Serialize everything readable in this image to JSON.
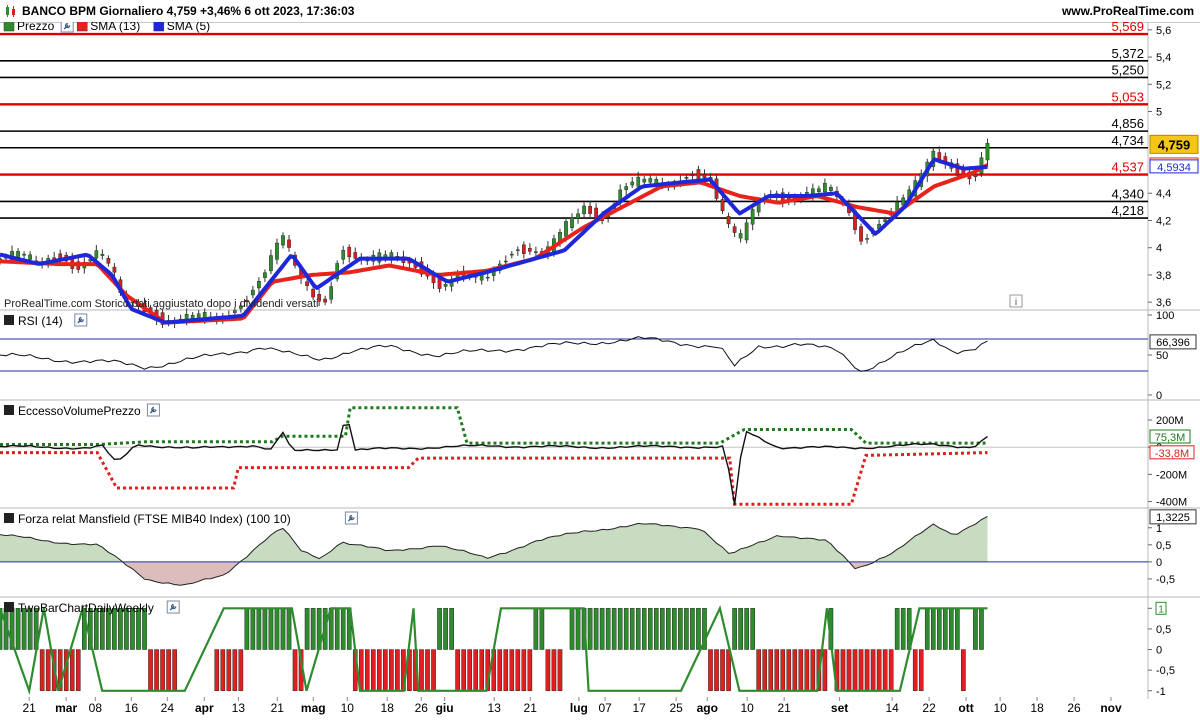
{
  "header": {
    "title": "BANCO BPM Giornaliero 4,759 +3,46% 6 ott 2023, 17:36:03",
    "site": "www.ProRealTime.com"
  },
  "colors": {
    "price_up": "#2e8b2e",
    "price_down": "#d62020",
    "sma13": "#e8231c",
    "sma5": "#1e28d8",
    "level_red": "#e00000",
    "level_black": "#000000",
    "rsi_band": "#2030a0",
    "highlight": "#f5c518"
  },
  "icons": [
    "candlestick-logo-icon",
    "wrench-icon",
    "info-icon"
  ],
  "price_panel": {
    "legend": [
      {
        "label": "Prezzo",
        "color": "#2e8b2e",
        "icon": "candlestick-icon"
      },
      {
        "label": "SMA (13)",
        "color": "#e8231c"
      },
      {
        "label": "SMA (5)",
        "color": "#1e28d8"
      }
    ],
    "watermark": "ProRealTime.com  Storico dati aggiustato dopo i dividendi versati",
    "levels": [
      {
        "value": 5.569,
        "label": "5,569",
        "color": "red"
      },
      {
        "value": 5.372,
        "label": "5,372",
        "color": "black"
      },
      {
        "value": 5.25,
        "label": "5,250",
        "color": "black"
      },
      {
        "value": 5.053,
        "label": "5,053",
        "color": "red"
      },
      {
        "value": 4.856,
        "label": "4,856",
        "color": "black"
      },
      {
        "value": 4.734,
        "label": "4,734",
        "color": "black"
      },
      {
        "value": 4.537,
        "label": "4,537",
        "color": "red"
      },
      {
        "value": 4.34,
        "label": "4,340",
        "color": "black"
      },
      {
        "value": 4.218,
        "label": "4,218",
        "color": "black"
      }
    ],
    "y_ticks": [
      {
        "v": 5.6,
        "label": "5,6"
      },
      {
        "v": 5.4,
        "label": "5,4"
      },
      {
        "v": 5.2,
        "label": "5,2"
      },
      {
        "v": 5.0,
        "label": "5"
      },
      {
        "v": 4.4,
        "label": "4,4"
      },
      {
        "v": 4.2,
        "label": "4,2"
      },
      {
        "v": 4.0,
        "label": "4"
      },
      {
        "v": 3.8,
        "label": "3,8"
      },
      {
        "v": 3.6,
        "label": "3,6"
      }
    ],
    "badges": [
      {
        "value": 4.759,
        "label": "4,759",
        "style": "price"
      },
      {
        "value": 4.6075,
        "label": "4,6075",
        "style": "sma13"
      },
      {
        "value": 4.5934,
        "label": "4,5934",
        "style": "sma5"
      }
    ]
  },
  "rsi_panel": {
    "legend": "RSI (14)",
    "y_ticks": [
      {
        "v": 100,
        "label": "100"
      },
      {
        "v": 50,
        "label": "50"
      },
      {
        "v": 0,
        "label": "0"
      }
    ],
    "badge": "66,396"
  },
  "volume_panel": {
    "legend": "EccessoVolumePrezzo",
    "y_ticks": [
      {
        "v": 200,
        "label": "200M"
      },
      {
        "v": 0,
        "label": "0"
      },
      {
        "v": -200,
        "label": "-200M"
      },
      {
        "v": -400,
        "label": "-400M"
      }
    ],
    "badges": [
      "75,3M",
      "-33,8M"
    ]
  },
  "mansfield_panel": {
    "legend": "Forza relat Mansfield (FTSE MIB40 Index) (100 10)",
    "y_ticks": [
      {
        "v": 1,
        "label": "1"
      },
      {
        "v": 0.5,
        "label": "0,5"
      },
      {
        "v": 0,
        "label": "0"
      },
      {
        "v": -0.5,
        "label": "-0,5"
      }
    ],
    "badge": "1,3225"
  },
  "twobar_panel": {
    "legend": "TwoBarChartDailyWeekly",
    "y_ticks": [
      {
        "v": 1,
        "label": "1"
      },
      {
        "v": 0.5,
        "label": "0,5"
      },
      {
        "v": 0,
        "label": "0"
      },
      {
        "v": -0.5,
        "label": "-0,5"
      },
      {
        "v": -1,
        "label": "-1"
      }
    ],
    "badge": "1"
  },
  "x_axis": {
    "labels": [
      {
        "t": 0.03,
        "label": "21",
        "bold": false
      },
      {
        "t": 0.068,
        "label": "mar",
        "bold": true
      },
      {
        "t": 0.098,
        "label": "08",
        "bold": false
      },
      {
        "t": 0.135,
        "label": "16",
        "bold": false
      },
      {
        "t": 0.172,
        "label": "24",
        "bold": false
      },
      {
        "t": 0.21,
        "label": "apr",
        "bold": true
      },
      {
        "t": 0.245,
        "label": "13",
        "bold": false
      },
      {
        "t": 0.285,
        "label": "21",
        "bold": false
      },
      {
        "t": 0.322,
        "label": "mag",
        "bold": true
      },
      {
        "t": 0.357,
        "label": "10",
        "bold": false
      },
      {
        "t": 0.398,
        "label": "18",
        "bold": false
      },
      {
        "t": 0.433,
        "label": "26",
        "bold": false
      },
      {
        "t": 0.457,
        "label": "giu",
        "bold": true
      },
      {
        "t": 0.508,
        "label": "13",
        "bold": false
      },
      {
        "t": 0.545,
        "label": "21",
        "bold": false
      },
      {
        "t": 0.595,
        "label": "lug",
        "bold": true
      },
      {
        "t": 0.622,
        "label": "07",
        "bold": false
      },
      {
        "t": 0.657,
        "label": "17",
        "bold": false
      },
      {
        "t": 0.695,
        "label": "25",
        "bold": false
      },
      {
        "t": 0.727,
        "label": "ago",
        "bold": true
      },
      {
        "t": 0.768,
        "label": "10",
        "bold": false
      },
      {
        "t": 0.806,
        "label": "21",
        "bold": false
      },
      {
        "t": 0.863,
        "label": "set",
        "bold": true
      },
      {
        "t": 0.917,
        "label": "14",
        "bold": false
      },
      {
        "t": 0.955,
        "label": "22",
        "bold": false
      },
      {
        "t": 0.993,
        "label": "ott",
        "bold": true
      },
      {
        "t": 1.028,
        "label": "10",
        "bold": false
      },
      {
        "t": 1.066,
        "label": "18",
        "bold": false
      },
      {
        "t": 1.104,
        "label": "26",
        "bold": false
      },
      {
        "t": 1.142,
        "label": "nov",
        "bold": true
      }
    ]
  },
  "chart_data": {
    "type": "line",
    "series": [
      {
        "name": "Prezzo",
        "keyframes": [
          [
            0,
            3.92
          ],
          [
            0.02,
            3.96
          ],
          [
            0.04,
            3.88
          ],
          [
            0.06,
            3.95
          ],
          [
            0.08,
            3.85
          ],
          [
            0.1,
            3.97
          ],
          [
            0.115,
            3.85
          ],
          [
            0.125,
            3.62
          ],
          [
            0.15,
            3.55
          ],
          [
            0.17,
            3.45
          ],
          [
            0.2,
            3.5
          ],
          [
            0.23,
            3.48
          ],
          [
            0.25,
            3.6
          ],
          [
            0.27,
            3.8
          ],
          [
            0.29,
            4.1
          ],
          [
            0.305,
            3.82
          ],
          [
            0.32,
            3.65
          ],
          [
            0.335,
            3.6
          ],
          [
            0.35,
            4.0
          ],
          [
            0.37,
            3.9
          ],
          [
            0.4,
            3.95
          ],
          [
            0.43,
            3.86
          ],
          [
            0.455,
            3.7
          ],
          [
            0.47,
            3.8
          ],
          [
            0.5,
            3.78
          ],
          [
            0.53,
            4.0
          ],
          [
            0.56,
            3.95
          ],
          [
            0.58,
            4.15
          ],
          [
            0.6,
            4.3
          ],
          [
            0.62,
            4.2
          ],
          [
            0.64,
            4.45
          ],
          [
            0.66,
            4.5
          ],
          [
            0.69,
            4.45
          ],
          [
            0.71,
            4.55
          ],
          [
            0.73,
            4.5
          ],
          [
            0.745,
            4.2
          ],
          [
            0.76,
            4.05
          ],
          [
            0.775,
            4.3
          ],
          [
            0.79,
            4.4
          ],
          [
            0.81,
            4.35
          ],
          [
            0.83,
            4.4
          ],
          [
            0.85,
            4.45
          ],
          [
            0.87,
            4.3
          ],
          [
            0.885,
            4.05
          ],
          [
            0.9,
            4.15
          ],
          [
            0.92,
            4.3
          ],
          [
            0.94,
            4.45
          ],
          [
            0.96,
            4.7
          ],
          [
            0.975,
            4.6
          ],
          [
            0.99,
            4.55
          ],
          [
            1.0,
            4.5
          ],
          [
            1.015,
            4.759
          ]
        ]
      },
      {
        "name": "SMA (13)",
        "keyframes": [
          [
            0,
            3.9
          ],
          [
            0.06,
            3.88
          ],
          [
            0.1,
            3.88
          ],
          [
            0.13,
            3.65
          ],
          [
            0.17,
            3.45
          ],
          [
            0.25,
            3.48
          ],
          [
            0.28,
            3.75
          ],
          [
            0.32,
            3.8
          ],
          [
            0.36,
            3.82
          ],
          [
            0.4,
            3.87
          ],
          [
            0.45,
            3.8
          ],
          [
            0.5,
            3.83
          ],
          [
            0.55,
            3.92
          ],
          [
            0.6,
            4.15
          ],
          [
            0.64,
            4.3
          ],
          [
            0.68,
            4.45
          ],
          [
            0.72,
            4.48
          ],
          [
            0.76,
            4.38
          ],
          [
            0.8,
            4.33
          ],
          [
            0.84,
            4.38
          ],
          [
            0.88,
            4.3
          ],
          [
            0.92,
            4.25
          ],
          [
            0.96,
            4.45
          ],
          [
            1.0,
            4.55
          ],
          [
            1.015,
            4.6075
          ]
        ]
      },
      {
        "name": "SMA (5)",
        "keyframes": [
          [
            0,
            3.95
          ],
          [
            0.04,
            3.88
          ],
          [
            0.09,
            3.95
          ],
          [
            0.115,
            3.8
          ],
          [
            0.135,
            3.55
          ],
          [
            0.17,
            3.45
          ],
          [
            0.25,
            3.5
          ],
          [
            0.3,
            3.95
          ],
          [
            0.325,
            3.7
          ],
          [
            0.37,
            3.92
          ],
          [
            0.42,
            3.92
          ],
          [
            0.46,
            3.75
          ],
          [
            0.5,
            3.82
          ],
          [
            0.55,
            3.92
          ],
          [
            0.58,
            3.98
          ],
          [
            0.62,
            4.25
          ],
          [
            0.66,
            4.45
          ],
          [
            0.7,
            4.48
          ],
          [
            0.73,
            4.5
          ],
          [
            0.76,
            4.25
          ],
          [
            0.79,
            4.38
          ],
          [
            0.83,
            4.38
          ],
          [
            0.86,
            4.4
          ],
          [
            0.9,
            4.1
          ],
          [
            0.93,
            4.3
          ],
          [
            0.96,
            4.65
          ],
          [
            0.99,
            4.58
          ],
          [
            1.015,
            4.5934
          ]
        ]
      },
      {
        "name": "RSI (14)",
        "keyframes": [
          [
            0,
            50
          ],
          [
            0.05,
            45
          ],
          [
            0.12,
            40
          ],
          [
            0.15,
            35
          ],
          [
            0.2,
            45
          ],
          [
            0.27,
            60
          ],
          [
            0.3,
            50
          ],
          [
            0.33,
            45
          ],
          [
            0.36,
            55
          ],
          [
            0.4,
            60
          ],
          [
            0.45,
            50
          ],
          [
            0.5,
            55
          ],
          [
            0.55,
            60
          ],
          [
            0.6,
            65
          ],
          [
            0.66,
            70
          ],
          [
            0.7,
            65
          ],
          [
            0.74,
            60
          ],
          [
            0.755,
            35
          ],
          [
            0.78,
            60
          ],
          [
            0.82,
            65
          ],
          [
            0.86,
            55
          ],
          [
            0.885,
            30
          ],
          [
            0.92,
            50
          ],
          [
            0.96,
            68
          ],
          [
            0.98,
            55
          ],
          [
            1.0,
            58
          ],
          [
            1.015,
            66.396
          ]
        ]
      },
      {
        "name": "EccessoVolumePrezzo",
        "keyframes": [
          [
            0,
            5
          ],
          [
            0.09,
            -5
          ],
          [
            0.105,
            10
          ],
          [
            0.12,
            -120
          ],
          [
            0.14,
            20
          ],
          [
            0.2,
            -10
          ],
          [
            0.26,
            15
          ],
          [
            0.28,
            -20
          ],
          [
            0.29,
            120
          ],
          [
            0.3,
            -30
          ],
          [
            0.35,
            -10
          ],
          [
            0.355,
            300
          ],
          [
            0.365,
            -20
          ],
          [
            0.45,
            0
          ],
          [
            0.5,
            10
          ],
          [
            0.6,
            0
          ],
          [
            0.7,
            5
          ],
          [
            0.745,
            0
          ],
          [
            0.755,
            -430
          ],
          [
            0.765,
            120
          ],
          [
            0.8,
            0
          ],
          [
            0.88,
            -5
          ],
          [
            0.92,
            10
          ],
          [
            0.96,
            20
          ],
          [
            1.0,
            0
          ],
          [
            1.015,
            75.3
          ]
        ]
      },
      {
        "name": "Mansfield",
        "keyframes": [
          [
            0,
            0.8
          ],
          [
            0.05,
            0.6
          ],
          [
            0.1,
            0.5
          ],
          [
            0.13,
            -0.1
          ],
          [
            0.15,
            -0.5
          ],
          [
            0.19,
            -0.7
          ],
          [
            0.23,
            -0.4
          ],
          [
            0.27,
            0.6
          ],
          [
            0.29,
            1.0
          ],
          [
            0.31,
            0.3
          ],
          [
            0.33,
            0.1
          ],
          [
            0.35,
            0.6
          ],
          [
            0.4,
            0.3
          ],
          [
            0.45,
            0.5
          ],
          [
            0.5,
            0.1
          ],
          [
            0.55,
            0.6
          ],
          [
            0.6,
            0.9
          ],
          [
            0.66,
            1.1
          ],
          [
            0.72,
            1.0
          ],
          [
            0.75,
            0.2
          ],
          [
            0.8,
            0.8
          ],
          [
            0.85,
            0.6
          ],
          [
            0.88,
            -0.2
          ],
          [
            0.92,
            0.3
          ],
          [
            0.96,
            1.1
          ],
          [
            0.98,
            0.8
          ],
          [
            1.015,
            1.3225
          ]
        ]
      }
    ],
    "ylim": [
      3.55,
      5.65
    ],
    "x_range": [
      0,
      1.18
    ]
  }
}
